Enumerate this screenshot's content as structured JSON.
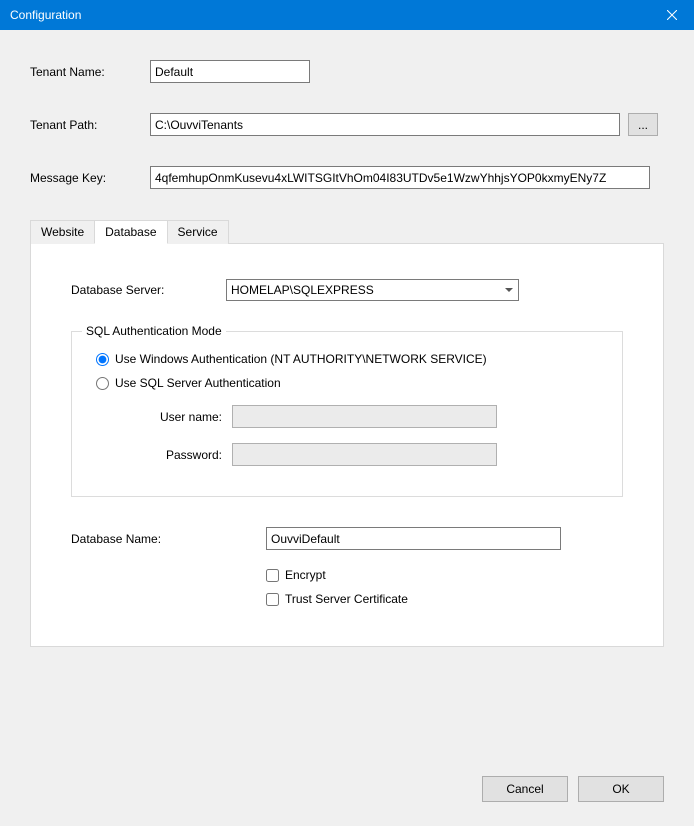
{
  "titlebar": {
    "title": "Configuration"
  },
  "form": {
    "tenant_name_label": "Tenant Name:",
    "tenant_name_value": "Default",
    "tenant_path_label": "Tenant Path:",
    "tenant_path_value": "C:\\OuvviTenants",
    "browse_label": "...",
    "message_key_label": "Message Key:",
    "message_key_value": "4qfemhupOnmKusevu4xLWITSGItVhOm04I83UTDv5e1WzwYhhjsYOP0kxmyENy7Z"
  },
  "tabs": {
    "items": [
      {
        "label": "Website",
        "active": false
      },
      {
        "label": "Database",
        "active": true
      },
      {
        "label": "Service",
        "active": false
      }
    ]
  },
  "database": {
    "server_label": "Database Server:",
    "server_value": "HOMELAP\\SQLEXPRESS",
    "auth_legend": "SQL Authentication Mode",
    "auth_windows_label": "Use Windows Authentication (NT AUTHORITY\\NETWORK SERVICE)",
    "auth_sql_label": "Use SQL Server Authentication",
    "username_label": "User name:",
    "username_value": "",
    "password_label": "Password:",
    "password_value": "",
    "dbname_label": "Database Name:",
    "dbname_value": "OuvviDefault",
    "encrypt_label": "Encrypt",
    "trust_label": "Trust Server Certificate"
  },
  "footer": {
    "cancel_label": "Cancel",
    "ok_label": "OK"
  }
}
